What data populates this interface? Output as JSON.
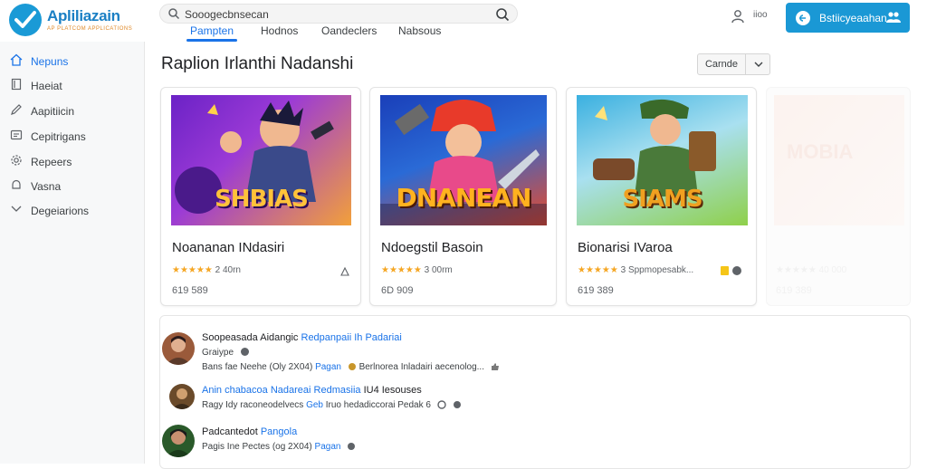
{
  "app": {
    "logo_text": "Apliliazain",
    "logo_subtitle": "AP PLATCOM APPLICATIONS"
  },
  "search": {
    "value": "Sooogecbnsecan",
    "icon_left": "search-icon",
    "icon_right": "search-icon"
  },
  "tabs": [
    {
      "label": "Pampten",
      "active": true
    },
    {
      "label": "Hodnos",
      "active": false
    },
    {
      "label": "Oandeclers",
      "active": false
    },
    {
      "label": "Nabsous",
      "active": false
    }
  ],
  "header": {
    "profile_icon": "person-icon",
    "small_label": "iioo",
    "signin_label": "Bstiicyeaahan",
    "signin_left_icon": "circle-e-icon",
    "signin_right_icon": "users-icon"
  },
  "sidebar": {
    "items": [
      {
        "label": "Nepuns",
        "icon": "home-icon",
        "active": true
      },
      {
        "label": "Haeiat",
        "icon": "document-icon",
        "active": false
      },
      {
        "label": "Aapitiicin",
        "icon": "pencil-icon",
        "active": false
      },
      {
        "label": "Cepitrigans",
        "icon": "card-icon",
        "active": false
      },
      {
        "label": "Repeers",
        "icon": "gear-icon",
        "active": false
      },
      {
        "label": "Vasna",
        "icon": "bell-icon",
        "active": false
      },
      {
        "label": "Degeiarions",
        "icon": "chevron-icon",
        "active": false
      }
    ]
  },
  "main": {
    "title": "Raplion Irlanthi Nadanshi",
    "sort_label": "Carnde"
  },
  "cards": [
    {
      "art_title": "SHBIAS",
      "name": "Noananan INdasiri",
      "stars": "★★★★★",
      "meta": "2 40rn",
      "price": "619 589",
      "colors": {
        "bg1": "#7b2fd0",
        "bg2": "#f08a2e",
        "title": "#ffc23a"
      }
    },
    {
      "art_title": "DNANEAN",
      "name": "Ndoegstil Basoin",
      "stars": "★★★★★",
      "meta": "3 00rm",
      "price": "6D 909",
      "colors": {
        "bg1": "#1a4fc9",
        "bg2": "#e84a2a",
        "title": "#ffb21f"
      }
    },
    {
      "art_title": "SIAMS",
      "name": "Bionarisi IVaroa",
      "stars": "★★★★★",
      "meta": "3 Sppmopesabk...",
      "price": "619 389",
      "colors": {
        "bg1": "#2a8fd0",
        "bg2": "#8fd04a",
        "title": "#f0a020"
      }
    }
  ],
  "ghost_card": {
    "title": "MOBIA",
    "meta": "★★★★★ 40 000",
    "price": "619 389"
  },
  "reviews": [
    {
      "name": "Soopeasada Aidangic",
      "link": "Redpanpaii Ih Padariai",
      "line2": "Graiype",
      "line3_a": "Bans fae Neehe (Oly 2X04)",
      "line3_link": "Pagan",
      "line3_b": "Berlnorea Inladairi aecenolog...",
      "avatar_bg": "#9a5a3a"
    },
    {
      "name": "Anin chabacoa Nadareai",
      "link": "Redmasiia",
      "name_suffix": "IU4 Iesouses",
      "line2": "Ragy Idy raconeodelvecs",
      "line2_link": "Geb",
      "line2_b": "Iruo hedadiccorai Pedak 6",
      "avatar_bg": "#6a4a2a"
    },
    {
      "name": "Padcantedot",
      "link": "Pangola",
      "line2": "Pagis Ine Pectes (og 2X04)",
      "line2_link": "Pagan",
      "avatar_bg": "#2a5a2a"
    }
  ],
  "colors": {
    "accent": "#1a73e8",
    "brand": "#1a98d5",
    "star": "#f5a623"
  }
}
